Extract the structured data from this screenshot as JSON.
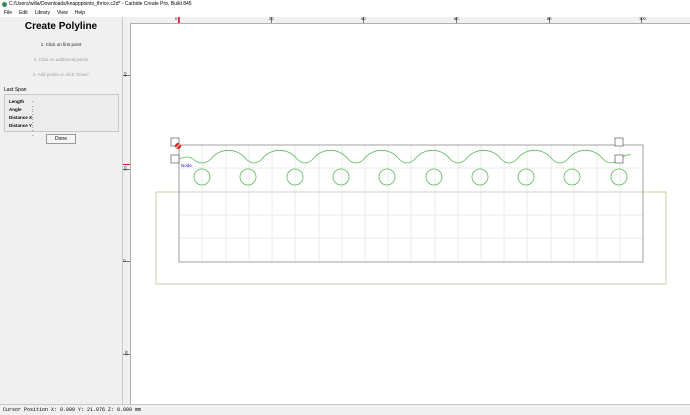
{
  "window": {
    "title": "C:/Users/willa/Downloads/knapppoints_thrice.c2d* - Carbide Create Pro, Build 845"
  },
  "menu": [
    "File",
    "Edit",
    "Library",
    "View",
    "Help"
  ],
  "panel": {
    "title": "Create Polyline",
    "step1": "1. Click on first point",
    "step2": "2. Click on additional points",
    "step3": "3. Add points or click \"Done\"",
    "last_span_label": "Last Span",
    "rows": [
      {
        "label": "Length",
        "value": "---"
      },
      {
        "label": "Angle",
        "value": "---"
      },
      {
        "label": "Distance X",
        "value": "---"
      },
      {
        "label": "Distance Y",
        "value": "---"
      }
    ],
    "done_label": "Done"
  },
  "ruler": {
    "top_labels": [
      "0",
      "20",
      "40",
      "60",
      "80",
      "100"
    ],
    "left_labels": [
      "40",
      "20",
      "0",
      "-20"
    ]
  },
  "canvas": {
    "node_label": "Node"
  },
  "status": {
    "cursor": "Cursor Position X: 0.000 Y: 21.076 Z: 0.000 mm"
  },
  "colors": {
    "panel_bg": "#f0f0f0",
    "geometry_green": "#5ab85a",
    "grid": "#d6d6d6",
    "outer_box": "#b8c58a",
    "node_red": "#e02020",
    "node_label_blue": "#2020c0"
  }
}
